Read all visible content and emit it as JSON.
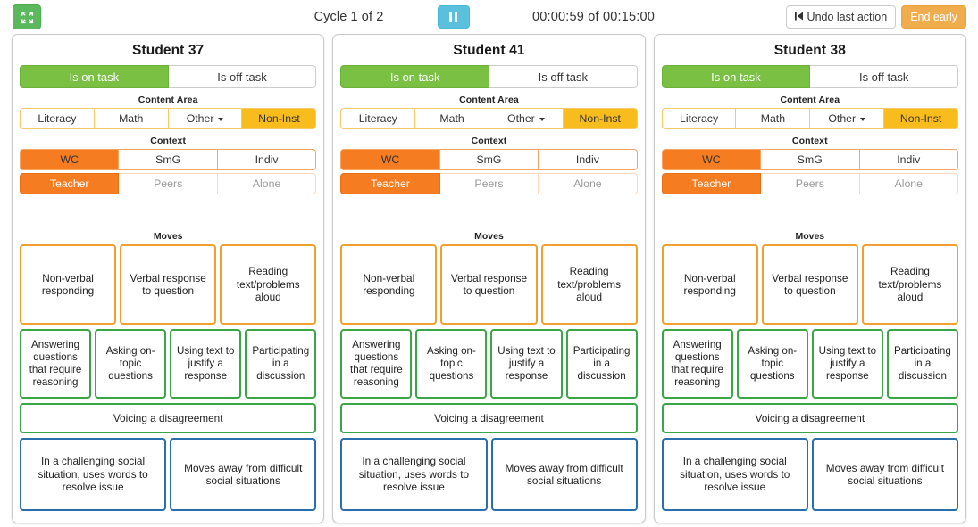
{
  "topbar": {
    "fullscreen_icon": "fullscreen-expand-icon",
    "cycle_label": "Cycle 1 of 2",
    "pause_icon": "pause-icon",
    "timer_label": "00:00:59 of 00:15:00",
    "undo_icon": "step-backward-icon",
    "undo_label": "Undo last action",
    "end_early_label": "End early"
  },
  "colors": {
    "green_active": "#7ac043",
    "amber_active": "#f9bc1d",
    "orange_active": "#f57c20",
    "pause_blue": "#5bc0de",
    "end_early_orange": "#f0ad4e",
    "card_orange_border": "#f0a02e",
    "card_green_border": "#3aa647",
    "card_blue_border": "#2a6ead"
  },
  "labels": {
    "content_area": "Content Area",
    "context": "Context",
    "moves": "Moves"
  },
  "task_options": [
    {
      "label": "Is on task",
      "state": "active"
    },
    {
      "label": "Is off task",
      "state": "inactive"
    }
  ],
  "content_area_options": [
    {
      "label": "Literacy",
      "state": "inactive",
      "caret": false
    },
    {
      "label": "Math",
      "state": "inactive",
      "caret": false
    },
    {
      "label": "Other",
      "state": "inactive",
      "caret": true
    },
    {
      "label": "Non-Inst",
      "state": "active",
      "caret": false
    }
  ],
  "context_row1_options": [
    {
      "label": "WC",
      "state": "active"
    },
    {
      "label": "SmG",
      "state": "inactive"
    },
    {
      "label": "Indiv",
      "state": "inactive"
    }
  ],
  "context_row2_options": [
    {
      "label": "Teacher",
      "state": "active"
    },
    {
      "label": "Peers",
      "state": "disabled"
    },
    {
      "label": "Alone",
      "state": "disabled"
    }
  ],
  "moves_row1": [
    "Non-verbal responding",
    "Verbal response to question",
    "Reading text/problems aloud"
  ],
  "moves_row2": [
    "Answering questions that require reasoning",
    "Asking on-topic questions",
    "Using text to justify a response",
    "Participating in a discussion"
  ],
  "moves_row3": [
    "Voicing a disagreement"
  ],
  "moves_row4": [
    "In a challenging social situation, uses words to resolve issue",
    "Moves away from difficult social situations"
  ],
  "panels": [
    {
      "title": "Student 37"
    },
    {
      "title": "Student 41"
    },
    {
      "title": "Student 38"
    }
  ]
}
